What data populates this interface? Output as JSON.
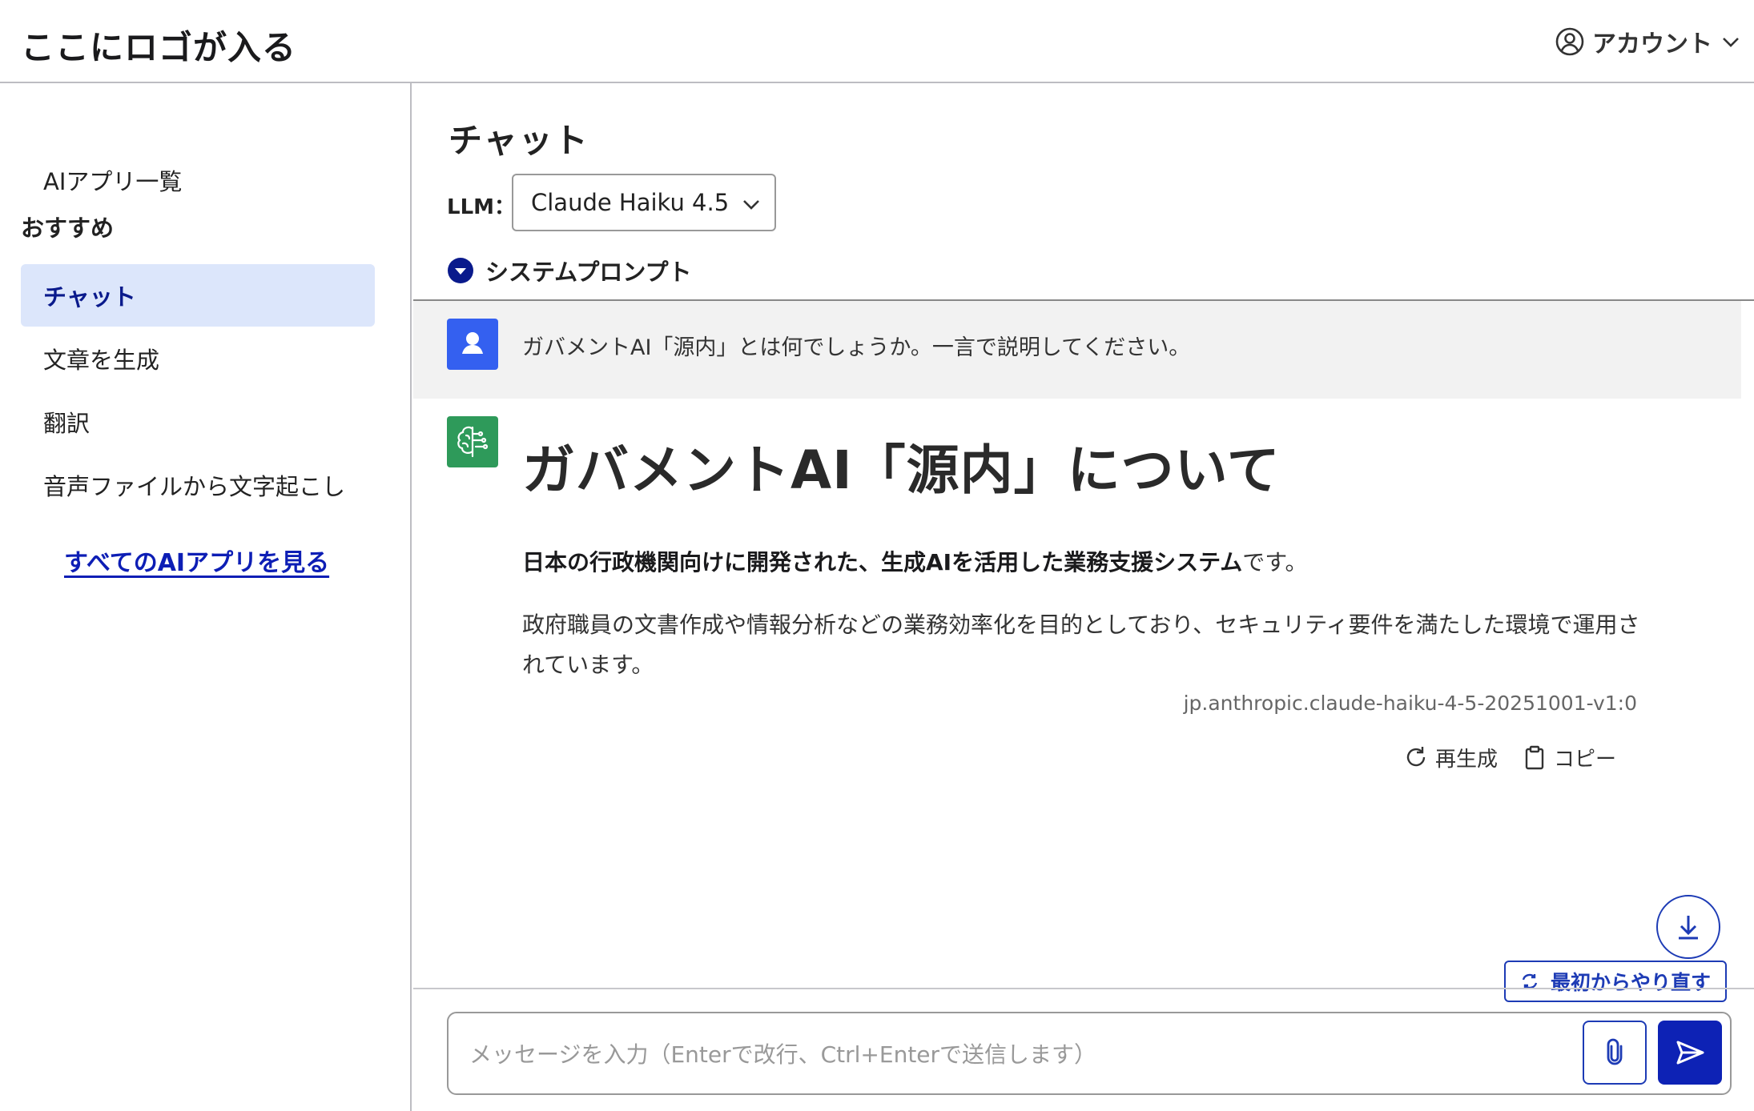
{
  "header": {
    "logo": "ここにロゴが入る",
    "account_label": "アカウント"
  },
  "sidebar": {
    "top_item": "AIアプリ一覧",
    "heading": "おすすめ",
    "items": [
      {
        "label": "チャット",
        "active": true
      },
      {
        "label": "文章を生成",
        "active": false
      },
      {
        "label": "翻訳",
        "active": false
      },
      {
        "label": "音声ファイルから文字起こし",
        "active": false
      }
    ],
    "all_apps_link": "すべてのAIアプリを見る"
  },
  "main": {
    "title": "チャット",
    "llm_label": "LLM：",
    "llm_selected": "Claude Haiku 4.5",
    "system_prompt_label": "システムプロンプト",
    "user_message": "ガバメントAI「源内」とは何でしょうか。一言で説明してください。",
    "answer": {
      "heading": "ガバメントAI「源内」について",
      "p1_bold": "日本の行政機関向けに開発された、生成AIを活用した業務支援システム",
      "p1_tail": "です。",
      "p2": "政府職員の文書作成や情報分析などの業務効率化を目的としており、セキュリティ要件を満たした環境で運用されています。",
      "model_id": "jp.anthropic.claude-haiku-4-5-20251001-v1:0",
      "regenerate_label": "再生成",
      "copy_label": "コピー"
    },
    "restart_label": "最初からやり直す",
    "input_placeholder": "メッセージを入力（Enterで改行、Ctrl+Enterで送信します）"
  },
  "colors": {
    "accent": "#0d22b5",
    "active_bg": "#dce6fb",
    "user_avatar": "#3460f0",
    "ai_avatar": "#2e9a5a"
  }
}
